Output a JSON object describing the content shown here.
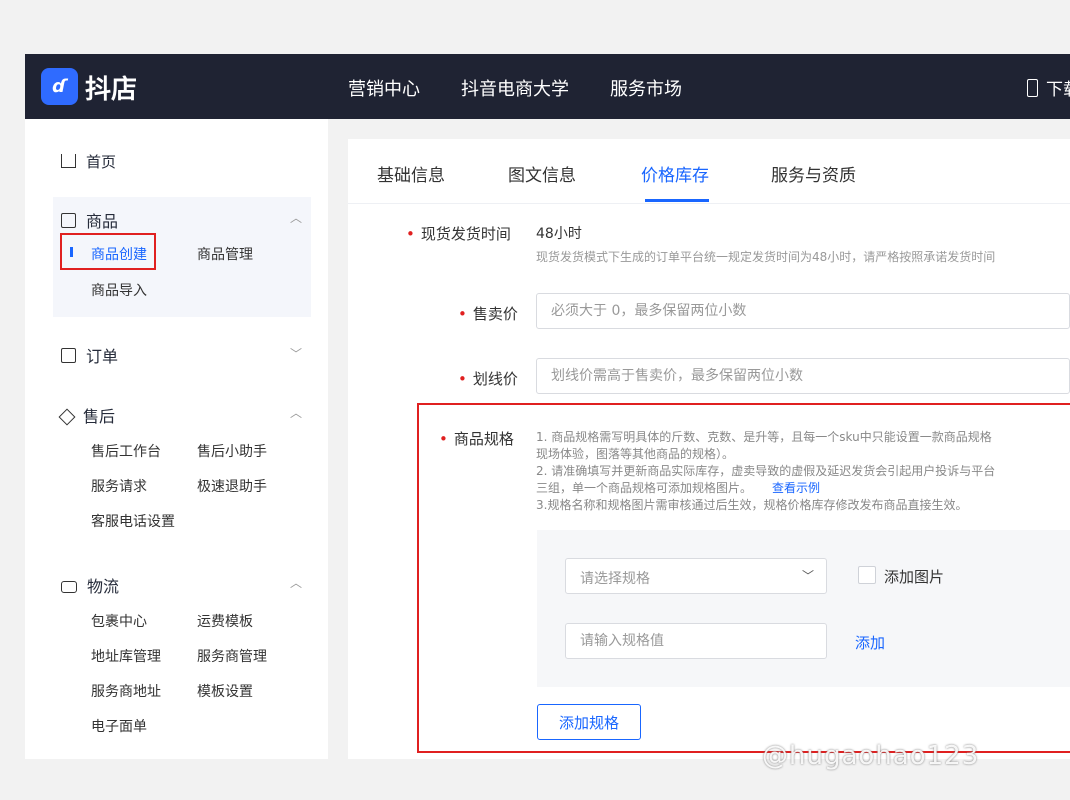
{
  "header": {
    "logo_icon": "douyin-shop-logo-icon",
    "app_name": "抖店",
    "nav": [
      "营销中心",
      "抖音电商大学",
      "服务市场"
    ],
    "download_label": "下载"
  },
  "sidebar": {
    "home": "首页",
    "groups": [
      {
        "title": "商品",
        "icon": "box-icon",
        "items": [
          "商品创建",
          "商品管理",
          "商品导入"
        ]
      },
      {
        "title": "订单",
        "icon": "order-icon",
        "items": []
      },
      {
        "title": "售后",
        "icon": "cube-icon",
        "items": [
          "售后工作台",
          "售后小助手",
          "服务请求",
          "极速退助手",
          "客服电话设置"
        ]
      },
      {
        "title": "物流",
        "icon": "truck-icon",
        "items": [
          "包裹中心",
          "运费模板",
          "地址库管理",
          "服务商管理",
          "服务商地址",
          "模板设置",
          "电子面单"
        ]
      }
    ],
    "active_item": "商品创建"
  },
  "tabs": [
    "基础信息",
    "图文信息",
    "价格库存",
    "服务与资质"
  ],
  "active_tab": "价格库存",
  "form": {
    "ship_time": {
      "label": "现货发货时间",
      "value": "48小时",
      "hint": "现货发货模式下生成的订单平台统一规定发货时间为48小时，请严格按照承诺发货时间"
    },
    "price": {
      "label": "售卖价",
      "placeholder": "必须大于 0，最多保留两位小数"
    },
    "strike_price": {
      "label": "划线价",
      "placeholder": "划线价需高于售卖价，最多保留两位小数"
    },
    "spec": {
      "label": "商品规格",
      "notes": [
        "1. 商品规格需写明具体的斤数、克数、是升等，且每一个sku中只能设置一款商品规格",
        "现场体验，图落等其他商品的规格）。",
        "2. 请准确填写并更新商品实际库存，虚卖导致的虚假及延迟发货会引起用户投诉与平台",
        "三组，单一个商品规格可添加规格图片。",
        "3.规格名称和规格图片需审核通过后生效，规格价格库存修改发布商品直接生效。"
      ],
      "example_link": "查看示例",
      "select_placeholder": "请选择规格",
      "add_image_label": "添加图片",
      "value_placeholder": "请输入规格值",
      "add_link": "添加",
      "add_spec_button": "添加规格"
    }
  },
  "watermark": "@hugaohao123",
  "colors": {
    "topbar": "#1f2333",
    "accent": "#1966ff",
    "highlight": "#e02020"
  }
}
